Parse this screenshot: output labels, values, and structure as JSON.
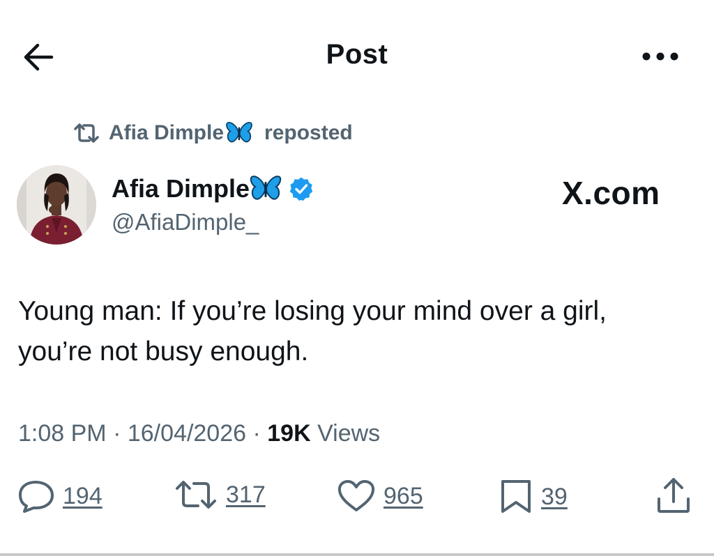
{
  "header": {
    "title": "Post",
    "back_icon": "arrow-left-icon",
    "more_icon": "more-dots-icon"
  },
  "repost": {
    "icon": "repost-icon",
    "name": "Afia Dimple",
    "emoji": "butterfly",
    "label": "reposted"
  },
  "author": {
    "name": "Afia Dimple",
    "emoji": "butterfly",
    "verified": true,
    "handle": "@AfiaDimple_"
  },
  "watermark": "X.com",
  "post": {
    "text_line1": "Young man: If you’re losing your mind over a girl,",
    "text_line2": "you’re not busy enough."
  },
  "meta": {
    "time": "1:08 PM",
    "separator": "·",
    "date": "16/04/2026",
    "views_count": "19K",
    "views_label": "Views"
  },
  "actions": {
    "replies": "194",
    "reposts": "317",
    "likes": "965",
    "bookmarks": "39"
  },
  "colors": {
    "text": "#0f1419",
    "secondary": "#536471",
    "verified_blue": "#1d9bf0",
    "butterfly": "#1e9fe8"
  }
}
